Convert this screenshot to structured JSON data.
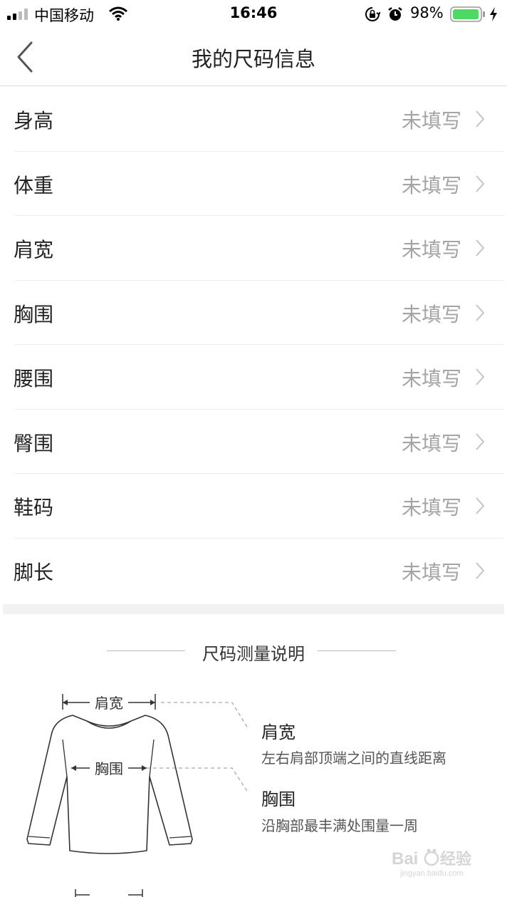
{
  "status_bar": {
    "carrier": "中国移动",
    "time": "16:46",
    "battery_percent": "98%",
    "battery_level": 0.98,
    "battery_color": "#4cd964",
    "icons": [
      "signal-icon",
      "wifi-icon",
      "rotation-lock-icon",
      "alarm-icon",
      "battery-icon",
      "charging-bolt-icon"
    ]
  },
  "nav": {
    "title": "我的尺码信息",
    "back_icon": "chevron-left-icon"
  },
  "size_list": {
    "items": [
      {
        "label": "身高",
        "value": "未填写"
      },
      {
        "label": "体重",
        "value": "未填写"
      },
      {
        "label": "肩宽",
        "value": "未填写"
      },
      {
        "label": "胸围",
        "value": "未填写"
      },
      {
        "label": "腰围",
        "value": "未填写"
      },
      {
        "label": "臀围",
        "value": "未填写"
      },
      {
        "label": "鞋码",
        "value": "未填写"
      },
      {
        "label": "脚长",
        "value": "未填写"
      }
    ],
    "chevron_icon": "chevron-right-icon"
  },
  "measure": {
    "section_title": "尺码测量说明",
    "figure_labels": {
      "shoulder": "肩宽",
      "chest": "胸围"
    },
    "items": [
      {
        "title": "肩宽",
        "desc": "左右肩部顶端之间的直线距离"
      },
      {
        "title": "胸围",
        "desc": "沿胸部最丰满处围量一周"
      }
    ]
  },
  "watermark": {
    "text": "Baidu经验",
    "subtext": "jingyan.baidu.com"
  }
}
